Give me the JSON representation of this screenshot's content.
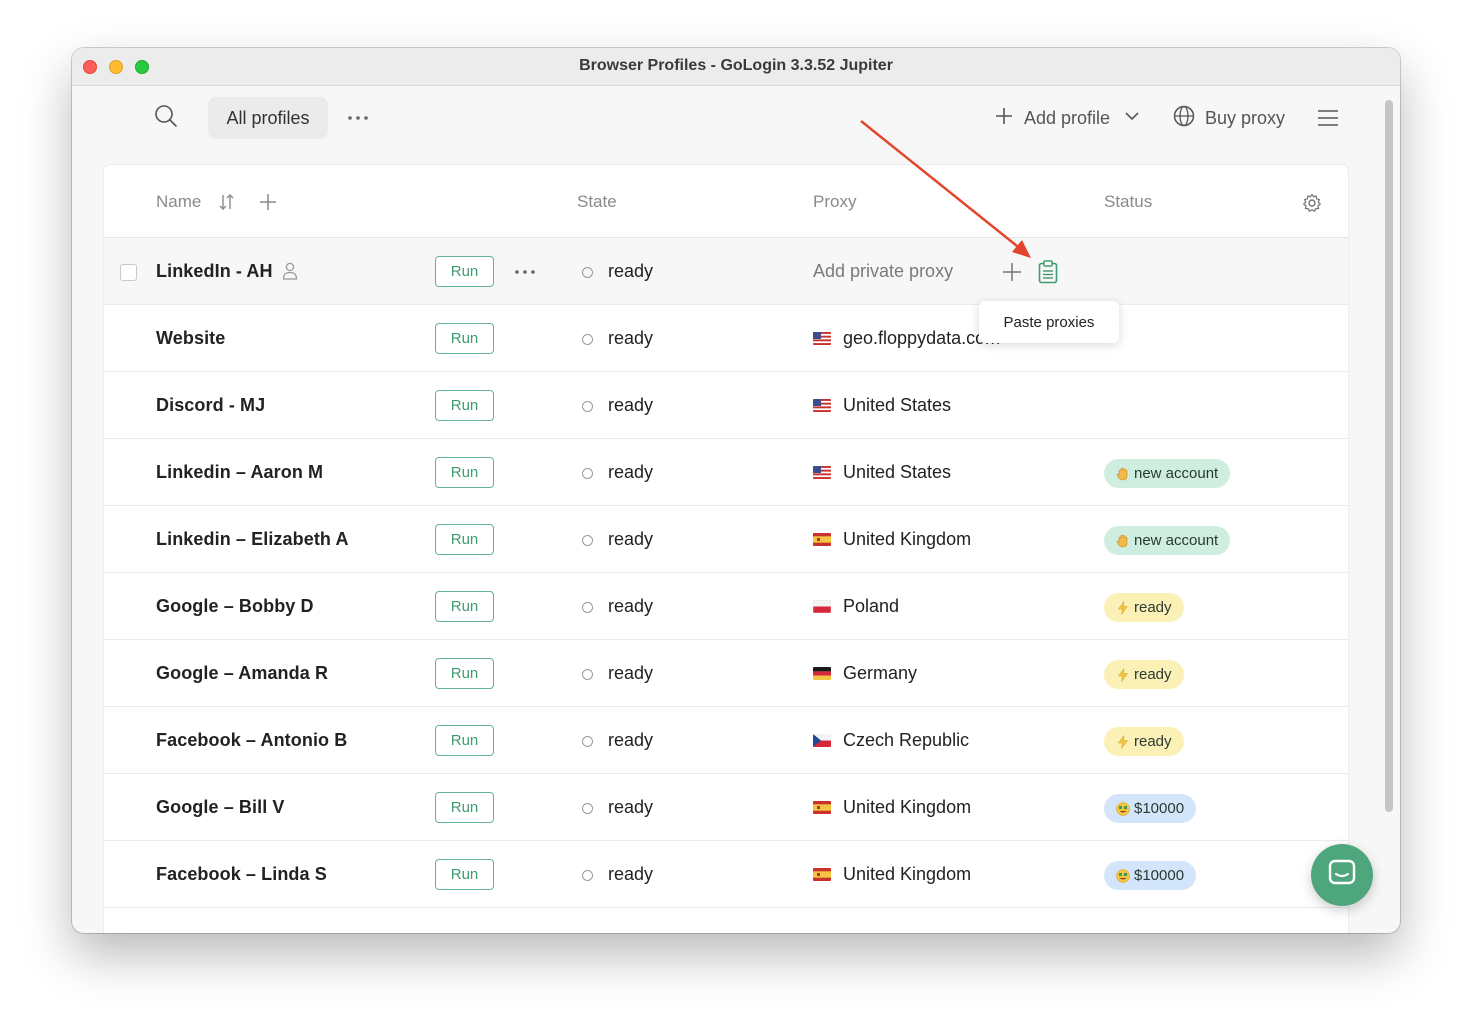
{
  "window": {
    "title": "Browser Profiles - GoLogin 3.3.52 Jupiter"
  },
  "toolbar": {
    "all_profiles": "All profiles",
    "add_profile": "Add profile",
    "buy_proxy": "Buy proxy"
  },
  "table": {
    "columns": {
      "name": "Name",
      "state": "State",
      "proxy": "Proxy",
      "status": "Status"
    },
    "run_label": "Run",
    "rows": [
      {
        "name": "LinkedIn - AH",
        "state": "ready",
        "proxy": "Add private proxy",
        "flag": "",
        "status": "",
        "status_color": ""
      },
      {
        "name": "Website",
        "state": "ready",
        "proxy": "geo.floppydata.com",
        "flag": "us",
        "status": "",
        "status_color": ""
      },
      {
        "name": "Discord - MJ",
        "state": "ready",
        "proxy": "United States",
        "flag": "us",
        "status": "",
        "status_color": ""
      },
      {
        "name": "Linkedin – Aaron M",
        "state": "ready",
        "proxy": "United States",
        "flag": "us",
        "status": "new account",
        "status_color": "green",
        "status_icon": "hand-icon"
      },
      {
        "name": "Linkedin – Elizabeth A",
        "state": "ready",
        "proxy": "United Kingdom",
        "flag": "es",
        "status": "new account",
        "status_color": "green",
        "status_icon": "hand-icon"
      },
      {
        "name": "Google – Bobby D",
        "state": "ready",
        "proxy": "Poland",
        "flag": "pl",
        "status": "ready",
        "status_color": "yellow",
        "status_icon": "lightning-icon"
      },
      {
        "name": "Google – Amanda R",
        "state": "ready",
        "proxy": "Germany",
        "flag": "de",
        "status": "ready",
        "status_color": "yellow",
        "status_icon": "lightning-icon"
      },
      {
        "name": "Facebook – Antonio B",
        "state": "ready",
        "proxy": "Czech Republic",
        "flag": "cz",
        "status": "ready",
        "status_color": "yellow",
        "status_icon": "lightning-icon"
      },
      {
        "name": "Google – Bill V",
        "state": "ready",
        "proxy": "United Kingdom",
        "flag": "es",
        "status": "$10000",
        "status_color": "blue",
        "status_icon": "money-face-icon"
      },
      {
        "name": "Facebook – Linda S",
        "state": "ready",
        "proxy": "United Kingdom",
        "flag": "es",
        "status": "$10000",
        "status_color": "blue",
        "status_icon": "money-face-icon"
      }
    ]
  },
  "tooltip": {
    "text": "Paste proxies"
  },
  "colors": {
    "accent": "#4ea67c",
    "annotation_arrow": "#e2452b"
  }
}
